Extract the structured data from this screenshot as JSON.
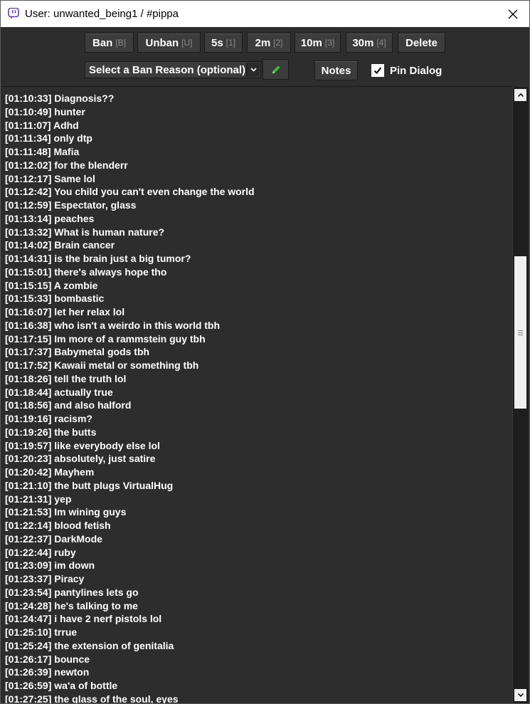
{
  "window": {
    "title": "User: unwanted_being1 / #pippa",
    "app_icon": "twitch-icon",
    "close_icon": "close-icon"
  },
  "toolbar": {
    "ban": {
      "label": "Ban",
      "key": "[B]"
    },
    "unban": {
      "label": "Unban",
      "key": "[U]"
    },
    "timeout_5s": {
      "label": "5s",
      "key": "[1]"
    },
    "timeout_2m": {
      "label": "2m",
      "key": "[2]"
    },
    "timeout_10m": {
      "label": "10m",
      "key": "[3]"
    },
    "timeout_30m": {
      "label": "30m",
      "key": "[4]"
    },
    "delete": {
      "label": "Delete"
    },
    "ban_reason": {
      "selected": "Select a Ban Reason (optional)"
    },
    "notes": {
      "label": "Notes"
    },
    "pin_dialog": {
      "label": "Pin Dialog",
      "checked": true
    }
  },
  "colors": {
    "background": "#2d2d2d",
    "text": "#ffffff",
    "key_hint": "#8a8a8a",
    "edit_icon": "#3fbf3f"
  },
  "messages": [
    {
      "time": "[01:10:33]",
      "text": "Diagnosis??"
    },
    {
      "time": "[01:10:49]",
      "text": "hunter"
    },
    {
      "time": "[01:11:07]",
      "text": "Adhd"
    },
    {
      "time": "[01:11:34]",
      "text": "only dtp"
    },
    {
      "time": "[01:11:48]",
      "text": "Mafia"
    },
    {
      "time": "[01:12:02]",
      "text": "for the blenderr"
    },
    {
      "time": "[01:12:17]",
      "text": "Same lol"
    },
    {
      "time": "[01:12:42]",
      "text": "You child you can't even change the world"
    },
    {
      "time": "[01:12:59]",
      "text": "Espectator, glass"
    },
    {
      "time": "[01:13:14]",
      "text": "peaches"
    },
    {
      "time": "[01:13:32]",
      "text": "What is human nature?"
    },
    {
      "time": "[01:14:02]",
      "text": "Brain cancer"
    },
    {
      "time": "[01:14:31]",
      "text": "is the brain just a big tumor?"
    },
    {
      "time": "[01:15:01]",
      "text": "there's always hope tho"
    },
    {
      "time": "[01:15:15]",
      "text": "A zombie"
    },
    {
      "time": "[01:15:33]",
      "text": "bombastic"
    },
    {
      "time": "[01:16:07]",
      "text": "let her relax lol"
    },
    {
      "time": "[01:16:38]",
      "text": "who isn't a weirdo in this world tbh"
    },
    {
      "time": "[01:17:15]",
      "text": "Im more of a rammstein guy tbh"
    },
    {
      "time": "[01:17:37]",
      "text": "Babymetal gods tbh"
    },
    {
      "time": "[01:17:52]",
      "text": "Kawaii metal or something tbh"
    },
    {
      "time": "[01:18:26]",
      "text": "tell the truth lol"
    },
    {
      "time": "[01:18:44]",
      "text": "actually true"
    },
    {
      "time": "[01:18:56]",
      "text": "and also halford"
    },
    {
      "time": "[01:19:16]",
      "text": "racism?"
    },
    {
      "time": "[01:19:26]",
      "text": "the butts"
    },
    {
      "time": "[01:19:57]",
      "text": "like  everybody else lol"
    },
    {
      "time": "[01:20:23]",
      "text": "absolutely, just satire"
    },
    {
      "time": "[01:20:42]",
      "text": "Mayhem"
    },
    {
      "time": "[01:21:10]",
      "text": "the butt plugs VirtualHug"
    },
    {
      "time": "[01:21:31]",
      "text": "yep"
    },
    {
      "time": "[01:21:53]",
      "text": "Im wining guys"
    },
    {
      "time": "[01:22:14]",
      "text": "blood fetish"
    },
    {
      "time": "[01:22:37]",
      "text": "DarkMode"
    },
    {
      "time": "[01:22:44]",
      "text": "ruby"
    },
    {
      "time": "[01:23:09]",
      "text": "im down"
    },
    {
      "time": "[01:23:37]",
      "text": "Piracy"
    },
    {
      "time": "[01:23:54]",
      "text": "pantylines lets go"
    },
    {
      "time": "[01:24:28]",
      "text": "he's talking to me"
    },
    {
      "time": "[01:24:47]",
      "text": "i have 2 nerf pistols lol"
    },
    {
      "time": "[01:25:10]",
      "text": "trrue"
    },
    {
      "time": "[01:25:24]",
      "text": "the extension of genitalia"
    },
    {
      "time": "[01:26:17]",
      "text": "bounce"
    },
    {
      "time": "[01:26:39]",
      "text": "newton"
    },
    {
      "time": "[01:26:59]",
      "text": "wa'a of bottle"
    },
    {
      "time": "[01:27:25]",
      "text": "the glass of the soul, eyes"
    }
  ]
}
